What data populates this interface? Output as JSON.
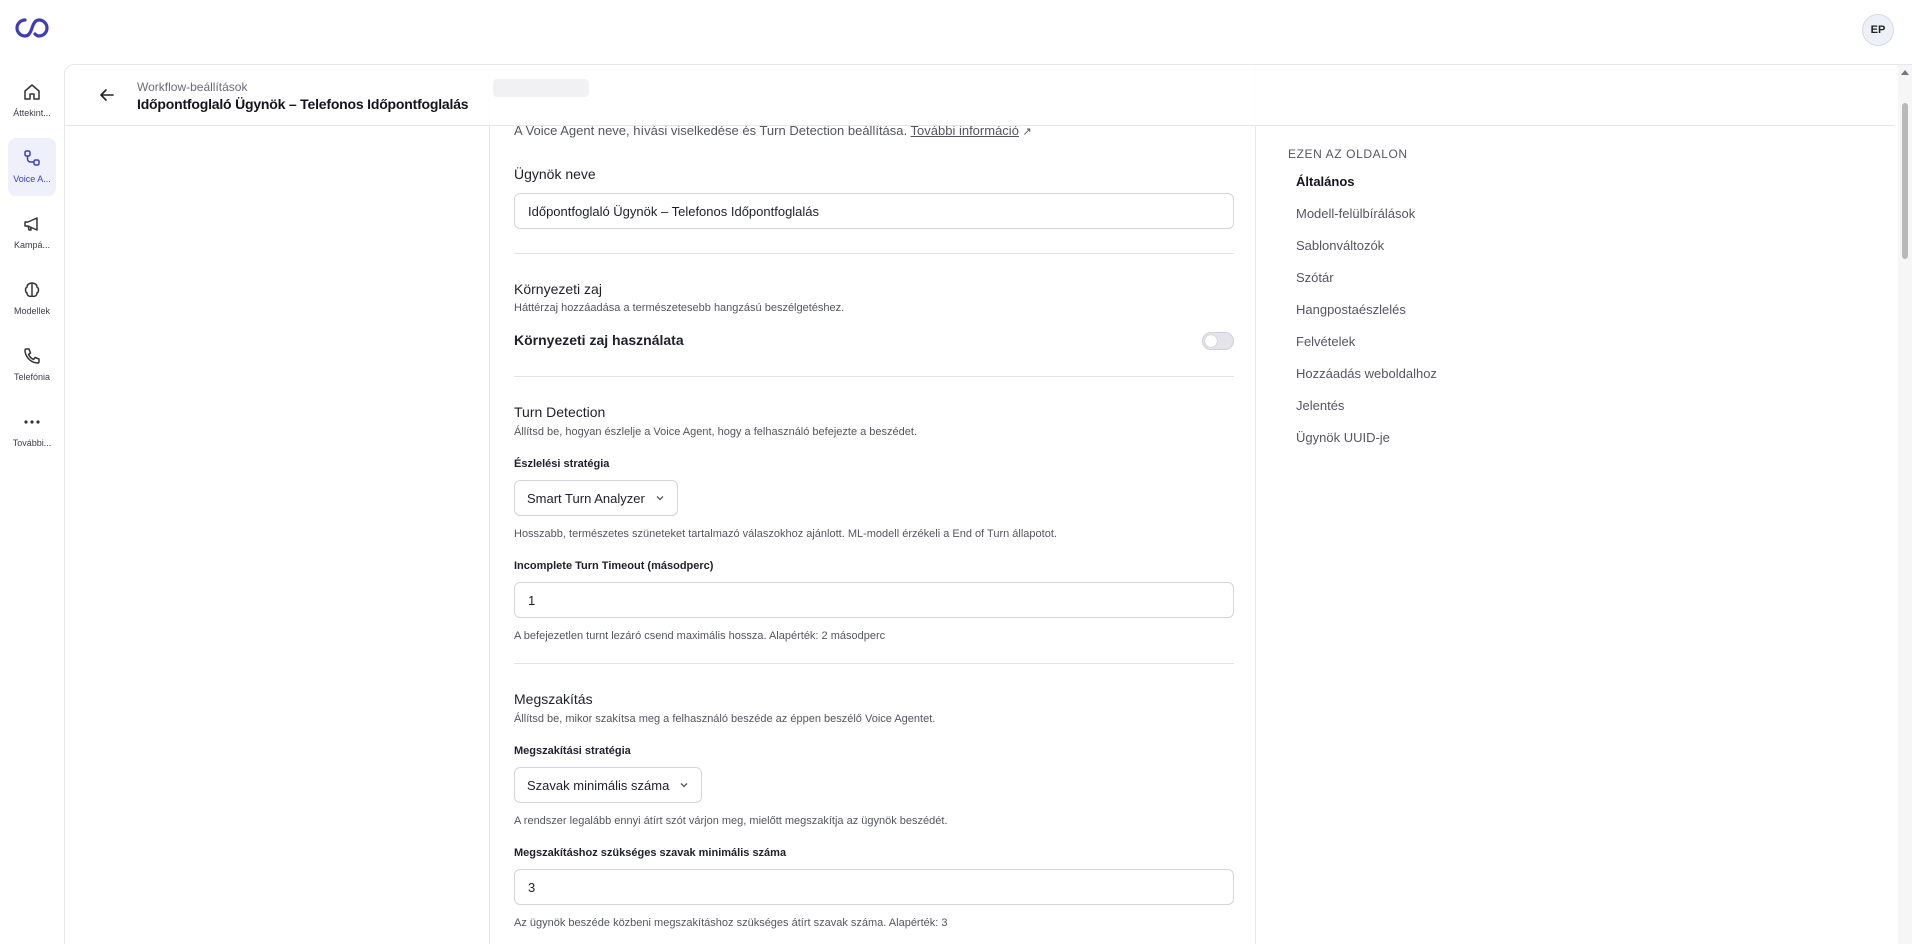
{
  "app": {
    "avatar_initials": "EP",
    "accent_color": "#3d3dba"
  },
  "sidebar": {
    "items": [
      {
        "label": "Áttekint...",
        "icon": "home-icon"
      },
      {
        "label": "Voice A...",
        "icon": "workflow-icon",
        "active": true
      },
      {
        "label": "Kampá...",
        "icon": "megaphone-icon"
      },
      {
        "label": "Modellek",
        "icon": "brain-icon"
      },
      {
        "label": "Telefónia",
        "icon": "phone-icon"
      },
      {
        "label": "További...",
        "icon": "more-icon"
      }
    ]
  },
  "header": {
    "breadcrumb": "Workflow-beállítások",
    "title": "Időpontfoglaló Ügynök – Telefonos Időpontfoglalás"
  },
  "general": {
    "description": "A Voice Agent neve, hívási viselkedése és Turn Detection beállítása.",
    "more_info_link": "További információ",
    "agent_name_label": "Ügynök neve",
    "agent_name_value": "Időpontfoglaló Ügynök – Telefonos Időpontfoglalás"
  },
  "ambient_noise": {
    "title": "Környezeti zaj",
    "description": "Háttérzaj hozzáadása a természetesebb hangzású beszélgetéshez.",
    "toggle_label": "Környezeti zaj használata",
    "enabled": false
  },
  "turn_detection": {
    "title": "Turn Detection",
    "description": "Állítsd be, hogyan észlelje a Voice Agent, hogy a felhasználó befejezte a beszédet.",
    "strategy_label": "Észlelési stratégia",
    "strategy_value": "Smart Turn Analyzer",
    "strategy_help": "Hosszabb, természetes szüneteket tartalmazó válaszokhoz ajánlott. ML-modell érzékeli a End of Turn állapotot.",
    "timeout_label": "Incomplete Turn Timeout (másodperc)",
    "timeout_value": "1",
    "timeout_help": "A befejezetlen turnt lezáró csend maximális hossza. Alapérték: 2 másodperc"
  },
  "interruption": {
    "title": "Megszakítás",
    "description": "Állítsd be, mikor szakítsa meg a felhasználó beszéde az éppen beszélő Voice Agentet.",
    "strategy_label": "Megszakítási stratégia",
    "strategy_value": "Szavak minimális száma",
    "strategy_help": "A rendszer legalább ennyi átírt szót várjon meg, mielőtt megszakítja az ügynök beszédét.",
    "min_words_label": "Megszakításhoz szükséges szavak minimális száma",
    "min_words_value": "3",
    "min_words_help": "Az ügynök beszéde közbeni megszakításhoz szükséges átírt szavak száma. Alapérték: 3"
  },
  "toc": {
    "title": "EZEN AZ OLDALON",
    "items": [
      {
        "label": "Általános",
        "active": true
      },
      {
        "label": "Modell-felülbírálások"
      },
      {
        "label": "Sablonváltozók"
      },
      {
        "label": "Szótár"
      },
      {
        "label": "Hangpostaészlelés"
      },
      {
        "label": "Felvételek"
      },
      {
        "label": "Hozzáadás weboldalhoz"
      },
      {
        "label": "Jelentés"
      },
      {
        "label": "Ügynök UUID-je"
      }
    ]
  }
}
